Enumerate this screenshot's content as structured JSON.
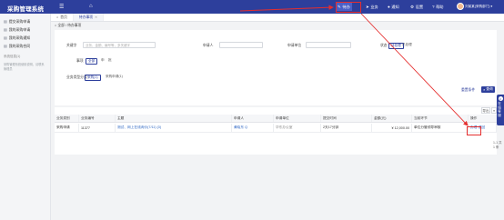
{
  "app": {
    "title": "采购管理系统"
  },
  "topnav": {
    "items": [
      {
        "label": "待办",
        "icon": "edit-icon",
        "active": true
      },
      {
        "label": "业务",
        "icon": "send-icon"
      },
      {
        "label": "通知",
        "icon": "chat-icon"
      },
      {
        "label": "设置",
        "icon": "gear-icon"
      },
      {
        "label": "帮助",
        "icon": "help-icon"
      }
    ],
    "user": "刘某某(采购部门) ▾"
  },
  "sidebar": {
    "items": [
      {
        "label": "提交采购申请"
      },
      {
        "label": "我的采购申请"
      },
      {
        "label": "我的采购通知"
      },
      {
        "label": "我的采购合同"
      }
    ],
    "group": "系统信息(1)",
    "note": [
      "采购管理系统使用说明，请联系管理员"
    ]
  },
  "tabs": [
    {
      "label": "首页"
    },
    {
      "label": "待办事项",
      "active": true
    }
  ],
  "breadcrumb": "⌂  全部 / 待办事项",
  "filters": {
    "keyword_label": "关键字",
    "keyword_placeholder": "业务、金额、编号等，多关键字",
    "applicant_label": "申请人",
    "dept_label": "申请单位",
    "status_label": "状态",
    "status_options": [
      "待处理",
      "已处理"
    ],
    "type_label": "事项",
    "type_options": [
      "全部",
      "申",
      "批"
    ],
    "category_label": "业务类型分类",
    "category_options": [
      "采购(1)",
      "采购申请(1)"
    ],
    "reset_label": "重置条件",
    "search_label": "查询"
  },
  "table": {
    "toolbar": [
      "导出",
      "≡"
    ],
    "headers": [
      "业务类别",
      "业务编号",
      "主题",
      "申请人",
      "申请单位",
      "提交时间",
      "金额(元)",
      "当前环节",
      "操作"
    ],
    "rows": [
      {
        "cells": [
          "采购申请",
          "11377",
          "测试、网上在线询价(7/11) (3)",
          "黄晓东 Q",
          "华东办公室",
          "2天17分钟",
          "¥ 12,000.00",
          "单位分管领导审核"
        ],
        "actions": [
          "办理",
          "退回"
        ]
      }
    ],
    "pagination": {
      "summary": "1-1 共 1 条",
      "prev": "‹",
      "page": "1",
      "next": "›"
    }
  },
  "float_panel": {
    "label": "在线客服",
    "icon": "service-icon"
  },
  "annotations": {
    "color": "#e52e2e"
  }
}
